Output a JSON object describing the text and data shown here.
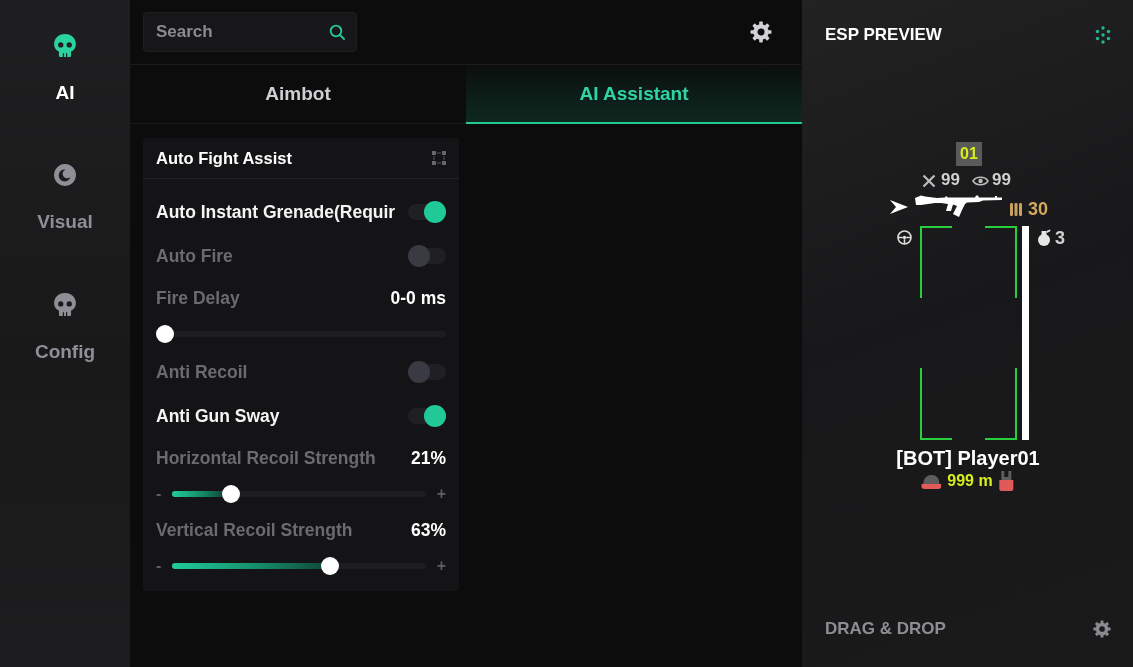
{
  "sidebar": {
    "items": [
      {
        "label": "AI",
        "selected": true
      },
      {
        "label": "Visual",
        "selected": false
      },
      {
        "label": "Config",
        "selected": false
      }
    ]
  },
  "search": {
    "placeholder": "Search"
  },
  "tabs": [
    {
      "label": "Aimbot",
      "selected": false
    },
    {
      "label": "AI Assistant",
      "selected": true
    }
  ],
  "panel": {
    "title": "Auto Fight Assist",
    "rows": [
      {
        "kind": "toggle",
        "label": "Auto Instant Grenade(Requir",
        "on": true
      },
      {
        "kind": "toggle",
        "label": "Auto Fire",
        "on": false
      },
      {
        "kind": "slider",
        "label": "Fire Delay",
        "reading": "0-0 ms",
        "level": 0
      },
      {
        "kind": "toggle",
        "label": "Anti Recoil",
        "on": false
      },
      {
        "kind": "toggle",
        "label": "Anti Gun Sway",
        "on": true
      },
      {
        "kind": "slider",
        "label": "Horizontal Recoil Strength",
        "reading": "21%",
        "level": 0.21,
        "minus": "-",
        "plus": "+"
      },
      {
        "kind": "slider",
        "label": "Vertical Recoil Strength",
        "reading": "63%",
        "level": 0.63,
        "minus": "-",
        "plus": "+"
      }
    ]
  },
  "esp_preview": {
    "title": "ESP PREVIEW",
    "team_number": "01",
    "kills": "99",
    "spectators": "99",
    "ammo": "30",
    "grenades": "3",
    "player_name": "[BOT] Player01",
    "distance": "999 m",
    "footer": "DRAG & DROP"
  }
}
